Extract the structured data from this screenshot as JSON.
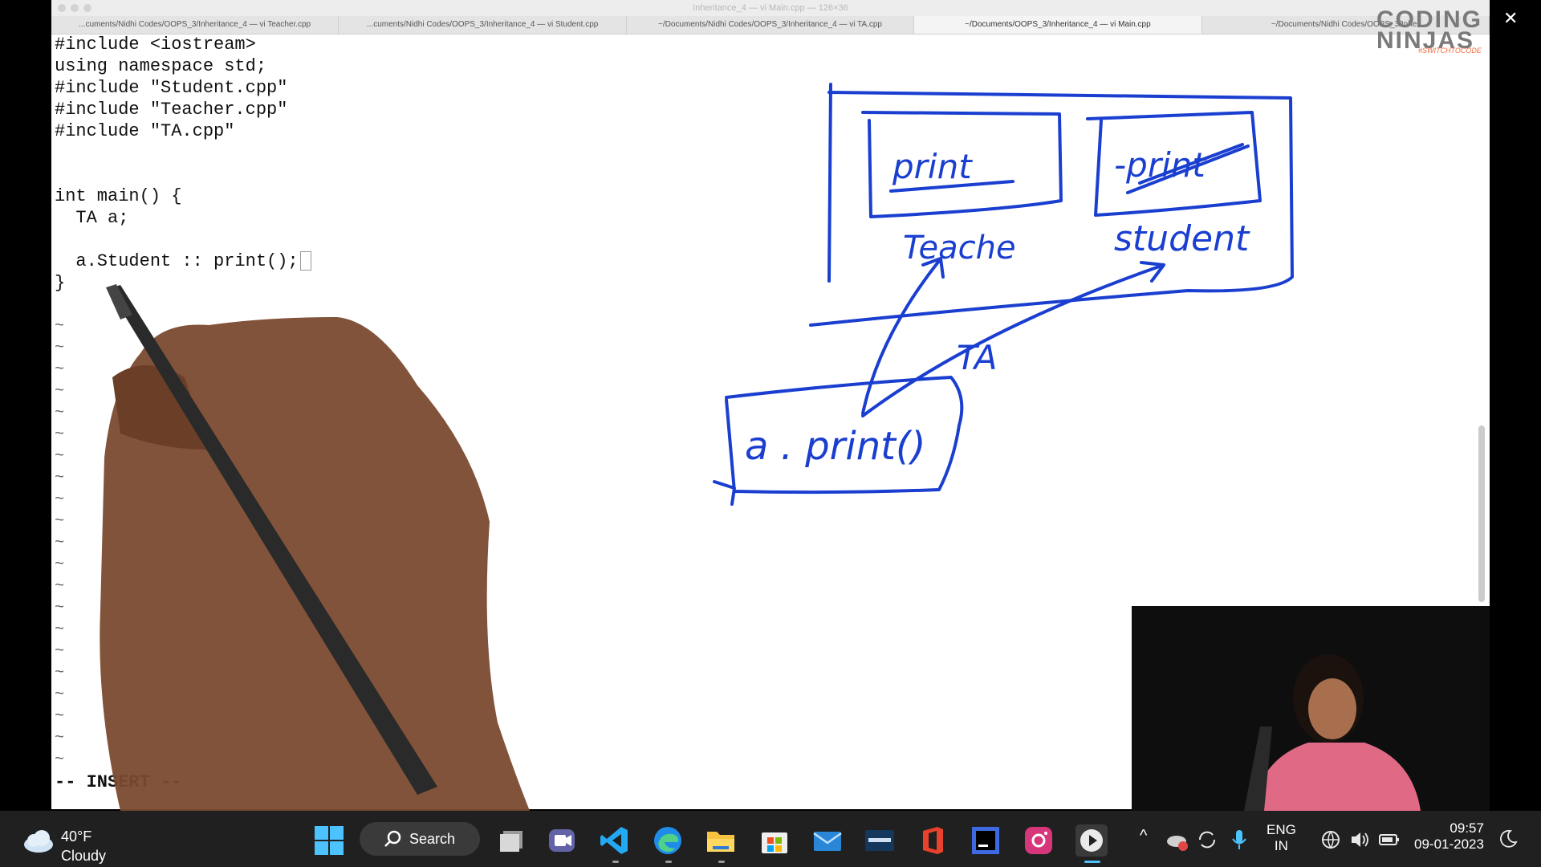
{
  "window": {
    "title": "Inheritance_4 — vi Main.cpp — 126×36",
    "tabs": [
      {
        "label": "...cuments/Nidhi Codes/OOPS_3/Inheritance_4 — vi Teacher.cpp",
        "active": false
      },
      {
        "label": "...cuments/Nidhi Codes/OOPS_3/Inheritance_4 — vi Student.cpp",
        "active": false
      },
      {
        "label": "~/Documents/Nidhi Codes/OOPS_3/Inheritance_4 — vi TA.cpp",
        "active": false
      },
      {
        "label": "~/Documents/OOPS_3/Inheritance_4 — vi Main.cpp",
        "active": true
      },
      {
        "label": "~/Documents/Nidhi Codes/OOPS_3/Inher",
        "active": false
      }
    ]
  },
  "editor": {
    "lines": [
      "#include <iostream>",
      "using namespace std;",
      "#include \"Student.cpp\"",
      "#include \"Teacher.cpp\"",
      "#include \"TA.cpp\"",
      "",
      "",
      "int main() {",
      "  TA a;",
      "",
      "  a.Student :: print();",
      "}"
    ],
    "tilde": "~",
    "tilde_count": 21,
    "mode": "-- INSERT --"
  },
  "drawing": {
    "labels": {
      "teacher_print": "print",
      "student_print": "-print",
      "teacher": "Teache",
      "student": "student",
      "ta": "TA",
      "call": "a . print()"
    },
    "color": "#1a3fd0"
  },
  "brand": {
    "line1": "CODING",
    "line2": "NINJAS",
    "tagline": "#SWITCHTOCODE",
    "accent": "#f26a41"
  },
  "close_symbol": "✕",
  "taskbar": {
    "weather_temp": "40°F",
    "weather_desc": "Cloudy",
    "search_label": "Search",
    "apps": [
      "start-icon",
      "task-view-icon",
      "teams-icon",
      "vscode-icon",
      "edge-icon",
      "file-explorer-icon",
      "store-icon",
      "mail-icon",
      "mysql-icon",
      "office-icon",
      "intellij-icon",
      "instagram-icon",
      "media-player-icon"
    ],
    "tray_chevron": "^",
    "lang_line1": "ENG",
    "lang_line2": "IN",
    "time": "09:57",
    "date": "09-01-2023"
  }
}
